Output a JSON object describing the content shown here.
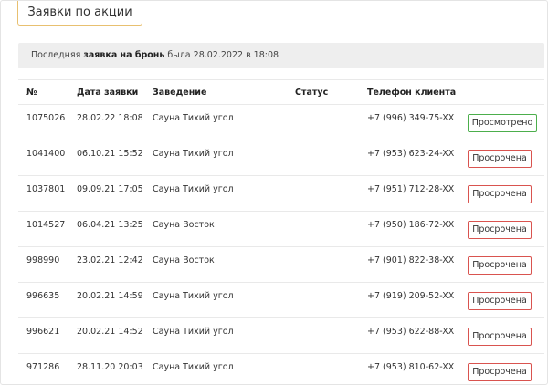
{
  "tab_label": "Заявки по акции",
  "notice": {
    "prefix": "Последняя ",
    "bold": "заявка на бронь",
    "suffix": " была 28.02.2022 в 18:08"
  },
  "table": {
    "headers": {
      "id": "№",
      "date": "Дата заявки",
      "venue": "Заведение",
      "status": "Статус",
      "phone": "Телефон клиента"
    },
    "rows": [
      {
        "id": "1075026",
        "date": "28.02.22 18:08",
        "venue": "Сауна Тихий угол",
        "phone": "+7 (996) 349-75-XX",
        "status": "Просмотрено",
        "status_kind": "viewed"
      },
      {
        "id": "1041400",
        "date": "06.10.21 15:52",
        "venue": "Сауна Тихий угол",
        "phone": "+7 (953) 623-24-XX",
        "status": "Просрочена",
        "status_kind": "expired"
      },
      {
        "id": "1037801",
        "date": "09.09.21 17:05",
        "venue": "Сауна Тихий угол",
        "phone": "+7 (951) 712-28-XX",
        "status": "Просрочена",
        "status_kind": "expired"
      },
      {
        "id": "1014527",
        "date": "06.04.21 13:25",
        "venue": "Сауна Восток",
        "phone": "+7 (950) 186-72-XX",
        "status": "Просрочена",
        "status_kind": "expired"
      },
      {
        "id": "998990",
        "date": "23.02.21 12:42",
        "venue": "Сауна Восток",
        "phone": "+7 (901) 822-38-XX",
        "status": "Просрочена",
        "status_kind": "expired"
      },
      {
        "id": "996635",
        "date": "20.02.21 14:59",
        "venue": "Сауна Тихий угол",
        "phone": "+7 (919) 209-52-XX",
        "status": "Просрочена",
        "status_kind": "expired"
      },
      {
        "id": "996621",
        "date": "20.02.21 14:52",
        "venue": "Сауна Тихий угол",
        "phone": "+7 (953) 622-88-XX",
        "status": "Просрочена",
        "status_kind": "expired"
      },
      {
        "id": "971286",
        "date": "28.11.20 20:03",
        "venue": "Сауна Тихий угол",
        "phone": "+7 (953) 810-62-XX",
        "status": "Просрочена",
        "status_kind": "expired"
      }
    ]
  },
  "colors": {
    "tab_border": "#e8c070",
    "viewed_border": "#4cae4c",
    "expired_border": "#d9534f"
  }
}
